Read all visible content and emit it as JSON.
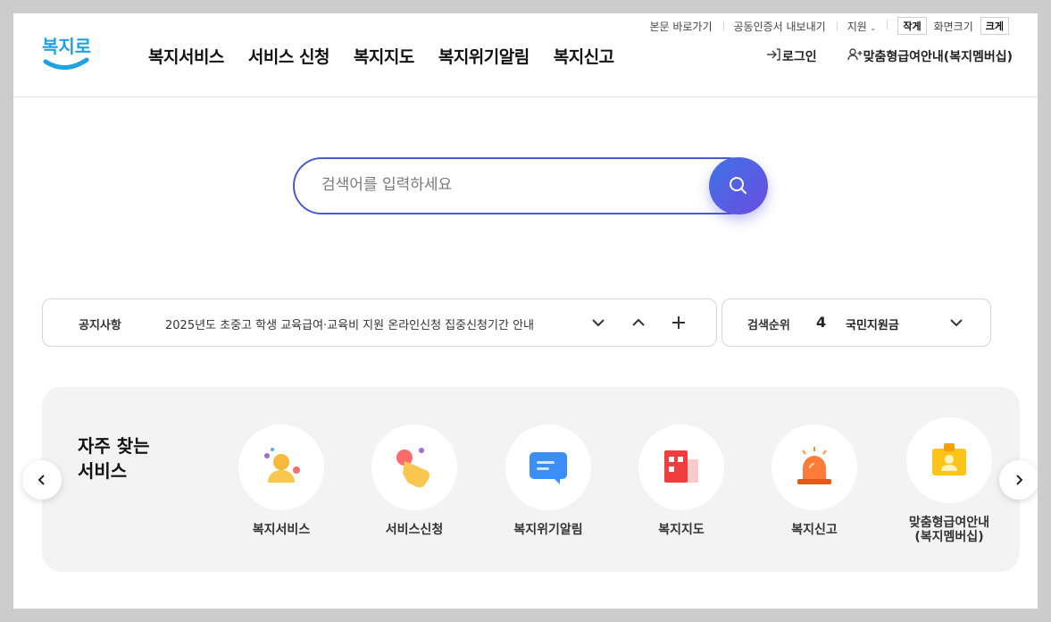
{
  "utility": {
    "skip_link": "본문 바로가기",
    "cert_export": "공동인증서 내보내기",
    "support": "지원",
    "font_small": "작게",
    "font_size_label": "화면크기",
    "font_large": "크게"
  },
  "header": {
    "logo_text": "복지로",
    "nav": [
      "복지서비스",
      "서비스 신청",
      "복지지도",
      "복지위기알림",
      "복지신고"
    ],
    "login": "로그인",
    "membership": "맞춤형급여안내(복지멤버십)"
  },
  "search": {
    "placeholder": "검색어를 입력하세요"
  },
  "notice": {
    "label": "공지사항",
    "text": "2025년도 초중고 학생 교육급여·교육비 지원 온라인신청 집중신청기간 안내"
  },
  "ranking": {
    "label": "검색순위",
    "number": "4",
    "keyword": "국민지원금"
  },
  "quick": {
    "title_line1": "자주 찾는",
    "title_line2": "서비스",
    "items": [
      {
        "label": "복지서비스",
        "icon": "person-icon"
      },
      {
        "label": "서비스신청",
        "icon": "hand-pointer-icon"
      },
      {
        "label": "복지위기알림",
        "icon": "message-icon"
      },
      {
        "label": "복지지도",
        "icon": "building-icon"
      },
      {
        "label": "복지신고",
        "icon": "siren-icon"
      },
      {
        "label_line1": "맞춤형급여안내",
        "label_line2": "(복지멤버십)",
        "icon": "badge-icon"
      }
    ]
  },
  "colors": {
    "accent": "#4a5bd6",
    "brand_blue": "#1fa3e0"
  }
}
